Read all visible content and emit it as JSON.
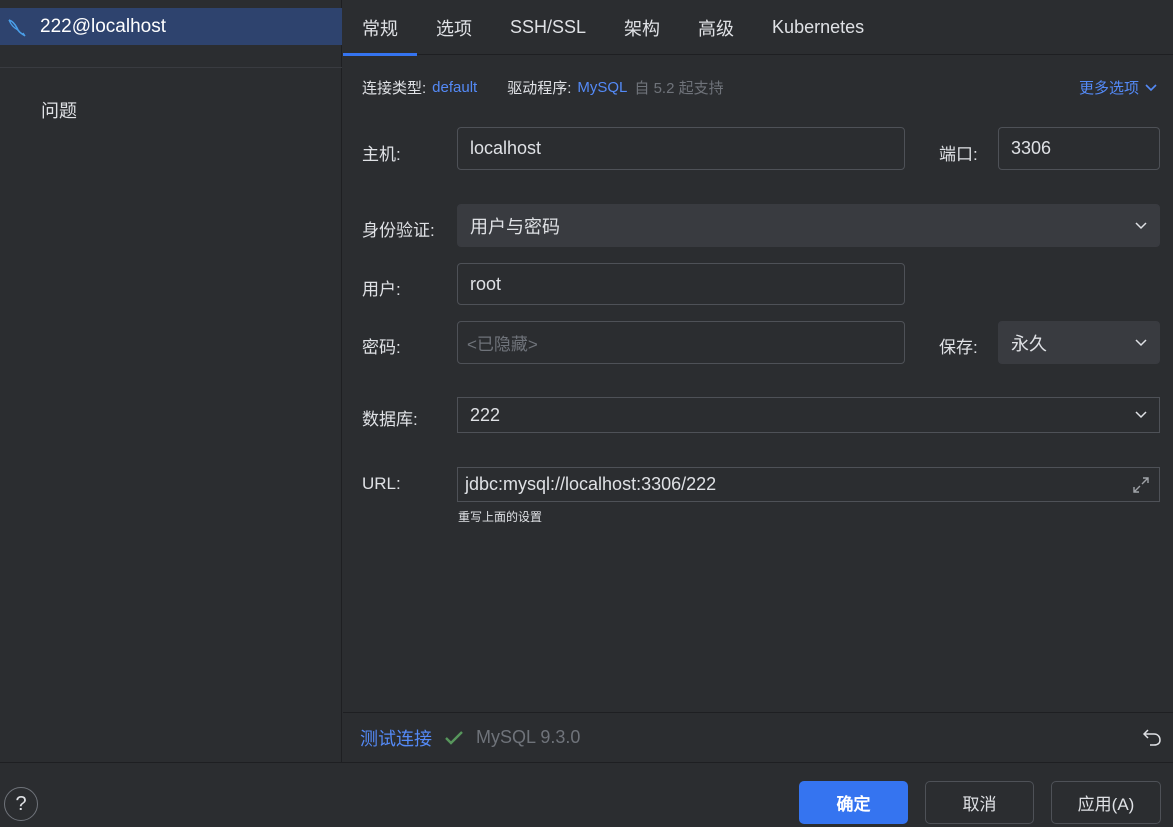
{
  "sidebar": {
    "connection_label": "222@localhost",
    "problems_label": "问题"
  },
  "tabs": [
    {
      "label": "常规",
      "active": true
    },
    {
      "label": "选项"
    },
    {
      "label": "SSH/SSL"
    },
    {
      "label": "架构"
    },
    {
      "label": "高级"
    },
    {
      "label": "Kubernetes"
    }
  ],
  "info": {
    "conn_type_label": "连接类型:",
    "conn_type_value": "default",
    "driver_label": "驱动程序:",
    "driver_value": "MySQL",
    "driver_note": "自 5.2 起支持",
    "more_options": "更多选项"
  },
  "form": {
    "host_label": "主机:",
    "host_value": "localhost",
    "port_label": "端口:",
    "port_value": "3306",
    "auth_label": "身份验证:",
    "auth_value": "用户与密码",
    "user_label": "用户:",
    "user_value": "root",
    "password_label": "密码:",
    "password_placeholder": "<已隐藏>",
    "save_label": "保存:",
    "save_value": "永久",
    "database_label": "数据库:",
    "database_value": "222",
    "url_label": "URL:",
    "url_value": "jdbc:mysql://localhost:3306/222",
    "url_hint": "重写上面的设置"
  },
  "test": {
    "link": "测试连接",
    "version": "MySQL 9.3.0"
  },
  "footer": {
    "help": "?",
    "ok": "确定",
    "cancel": "取消",
    "apply": "应用(A)"
  },
  "colors": {
    "accent": "#3574f0",
    "link": "#548af7",
    "success": "#57965c",
    "selection": "#2e436e"
  }
}
